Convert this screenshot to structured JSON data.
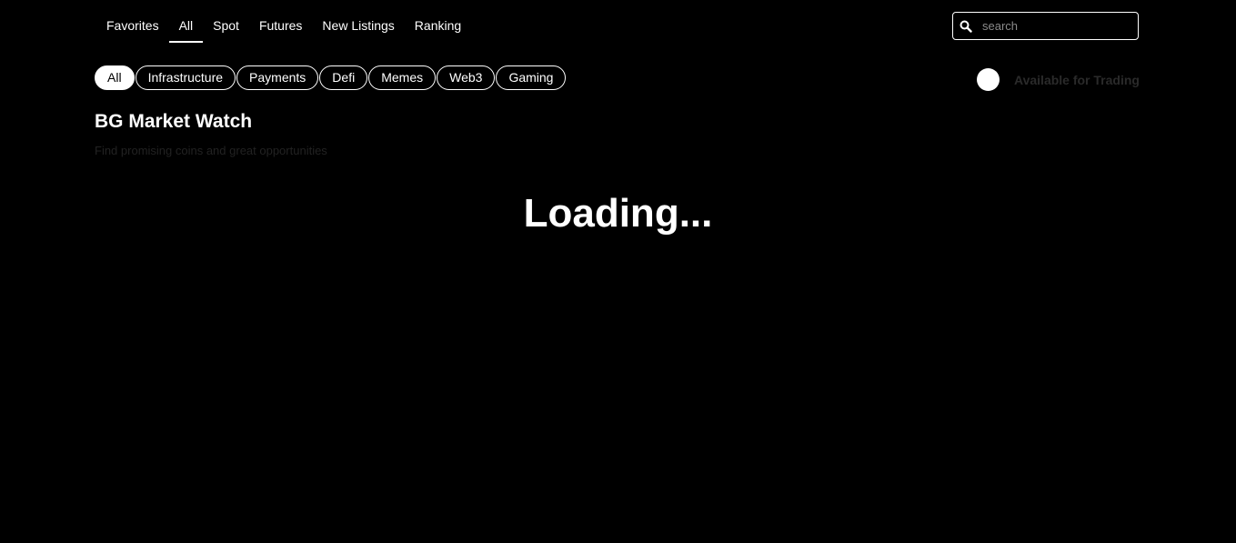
{
  "nav": {
    "tabs": [
      {
        "label": "Favorites",
        "active": false
      },
      {
        "label": "All",
        "active": true
      },
      {
        "label": "Spot",
        "active": false
      },
      {
        "label": "Futures",
        "active": false
      },
      {
        "label": "New Listings",
        "active": false
      },
      {
        "label": "Ranking",
        "active": false
      }
    ]
  },
  "search": {
    "placeholder": "search",
    "value": "",
    "icon": "search-icon"
  },
  "categories": {
    "items": [
      {
        "label": "All",
        "active": true
      },
      {
        "label": "Infrastructure",
        "active": false
      },
      {
        "label": "Payments",
        "active": false
      },
      {
        "label": "Defi",
        "active": false
      },
      {
        "label": "Memes",
        "active": false
      },
      {
        "label": "Web3",
        "active": false
      },
      {
        "label": "Gaming",
        "active": false
      }
    ]
  },
  "trading_filter": {
    "label": "Available for Trading",
    "enabled": false
  },
  "header": {
    "title": "BG Market Watch",
    "subtitle": "Find promising coins and great opportunities"
  },
  "status": {
    "loading_text": "Loading..."
  },
  "colors": {
    "background": "#000000",
    "foreground": "#ffffff",
    "muted": "#2a2a2a"
  }
}
